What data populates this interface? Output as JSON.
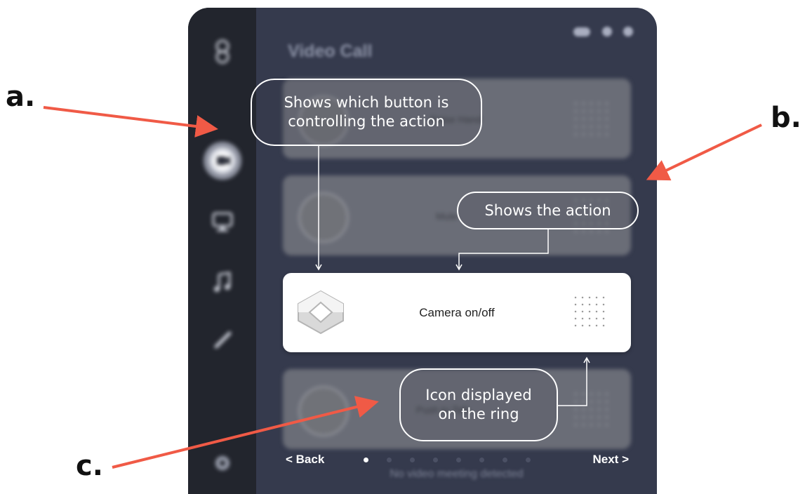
{
  "annotations": {
    "a": "a.",
    "b": "b.",
    "c": "c."
  },
  "app": {
    "title": "Video Call",
    "sidebar_icons": [
      "logo-icon",
      "camera-icon",
      "monitor-icon",
      "music-icon",
      "pen-icon",
      "settings-icon"
    ],
    "action_cards": [
      {
        "label": "Raise Hand"
      },
      {
        "label": "Mute"
      },
      {
        "label": "Camera on/off"
      },
      {
        "label": "Push to Talk"
      }
    ],
    "footer": {
      "back_label": "< Back",
      "next_label": "Next >",
      "page_count": 8,
      "current_page": 1,
      "status_text": "No video meeting detected"
    }
  },
  "callouts": {
    "button_source": "Shows which button is controlling the action",
    "action": "Shows the action",
    "ring_icon": "Icon displayed on the ring"
  },
  "colors": {
    "arrow": "#f05a46",
    "sidebar": "#22252d",
    "window": "#353a4d"
  }
}
